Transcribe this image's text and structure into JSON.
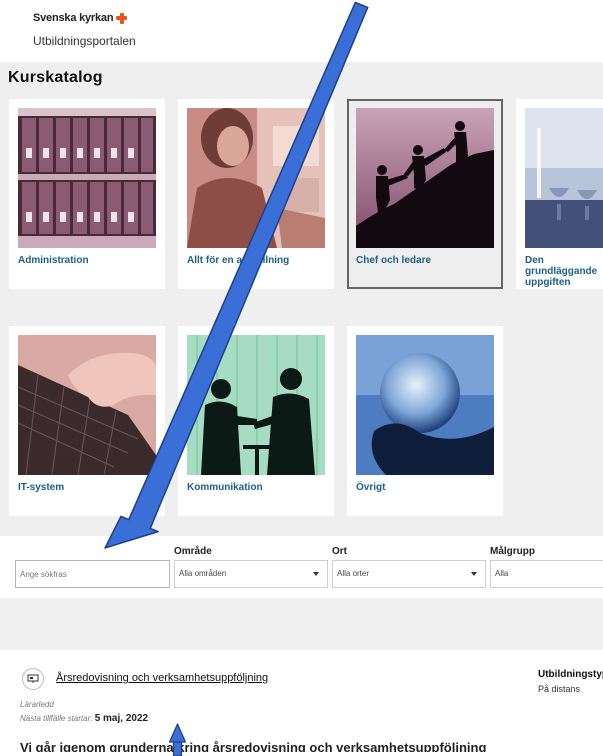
{
  "header": {
    "brand": "Svenska kyrkan",
    "portal_name": "Utbildningsportalen"
  },
  "catalog": {
    "title": "Kurskatalog",
    "cards": [
      {
        "label": "Administration"
      },
      {
        "label": "Allt för en anställning"
      },
      {
        "label": "Chef och ledare",
        "selected": true
      },
      {
        "label": "Den grundläggande uppgiften"
      },
      {
        "label": "IT-system"
      },
      {
        "label": "Kommunikation"
      },
      {
        "label": "Övrigt"
      }
    ]
  },
  "filters": {
    "search_placeholder": "Ange sökfras",
    "area_label": "Område",
    "area_value": "Alla områden",
    "place_label": "Ort",
    "place_value": "Alla orter",
    "target_label": "Målgrupp",
    "target_value": "Alla"
  },
  "result": {
    "title": "Årsredovisning och verksamhetsuppföljning",
    "side_title": "Utbildningstyp",
    "side_subtitle": "På distans",
    "type": "Lärarledd",
    "next_label": "Nästa tillfälle startar:",
    "next_date": "5 maj, 2022",
    "description": "Vi går igenom grunderna kring årsredovisning och verksamhetsuppföljning"
  },
  "colors": {
    "accent_link": "#1d5f8a",
    "annotation_arrow": "#3a6fd8",
    "brand_cross": "#e8541e"
  }
}
